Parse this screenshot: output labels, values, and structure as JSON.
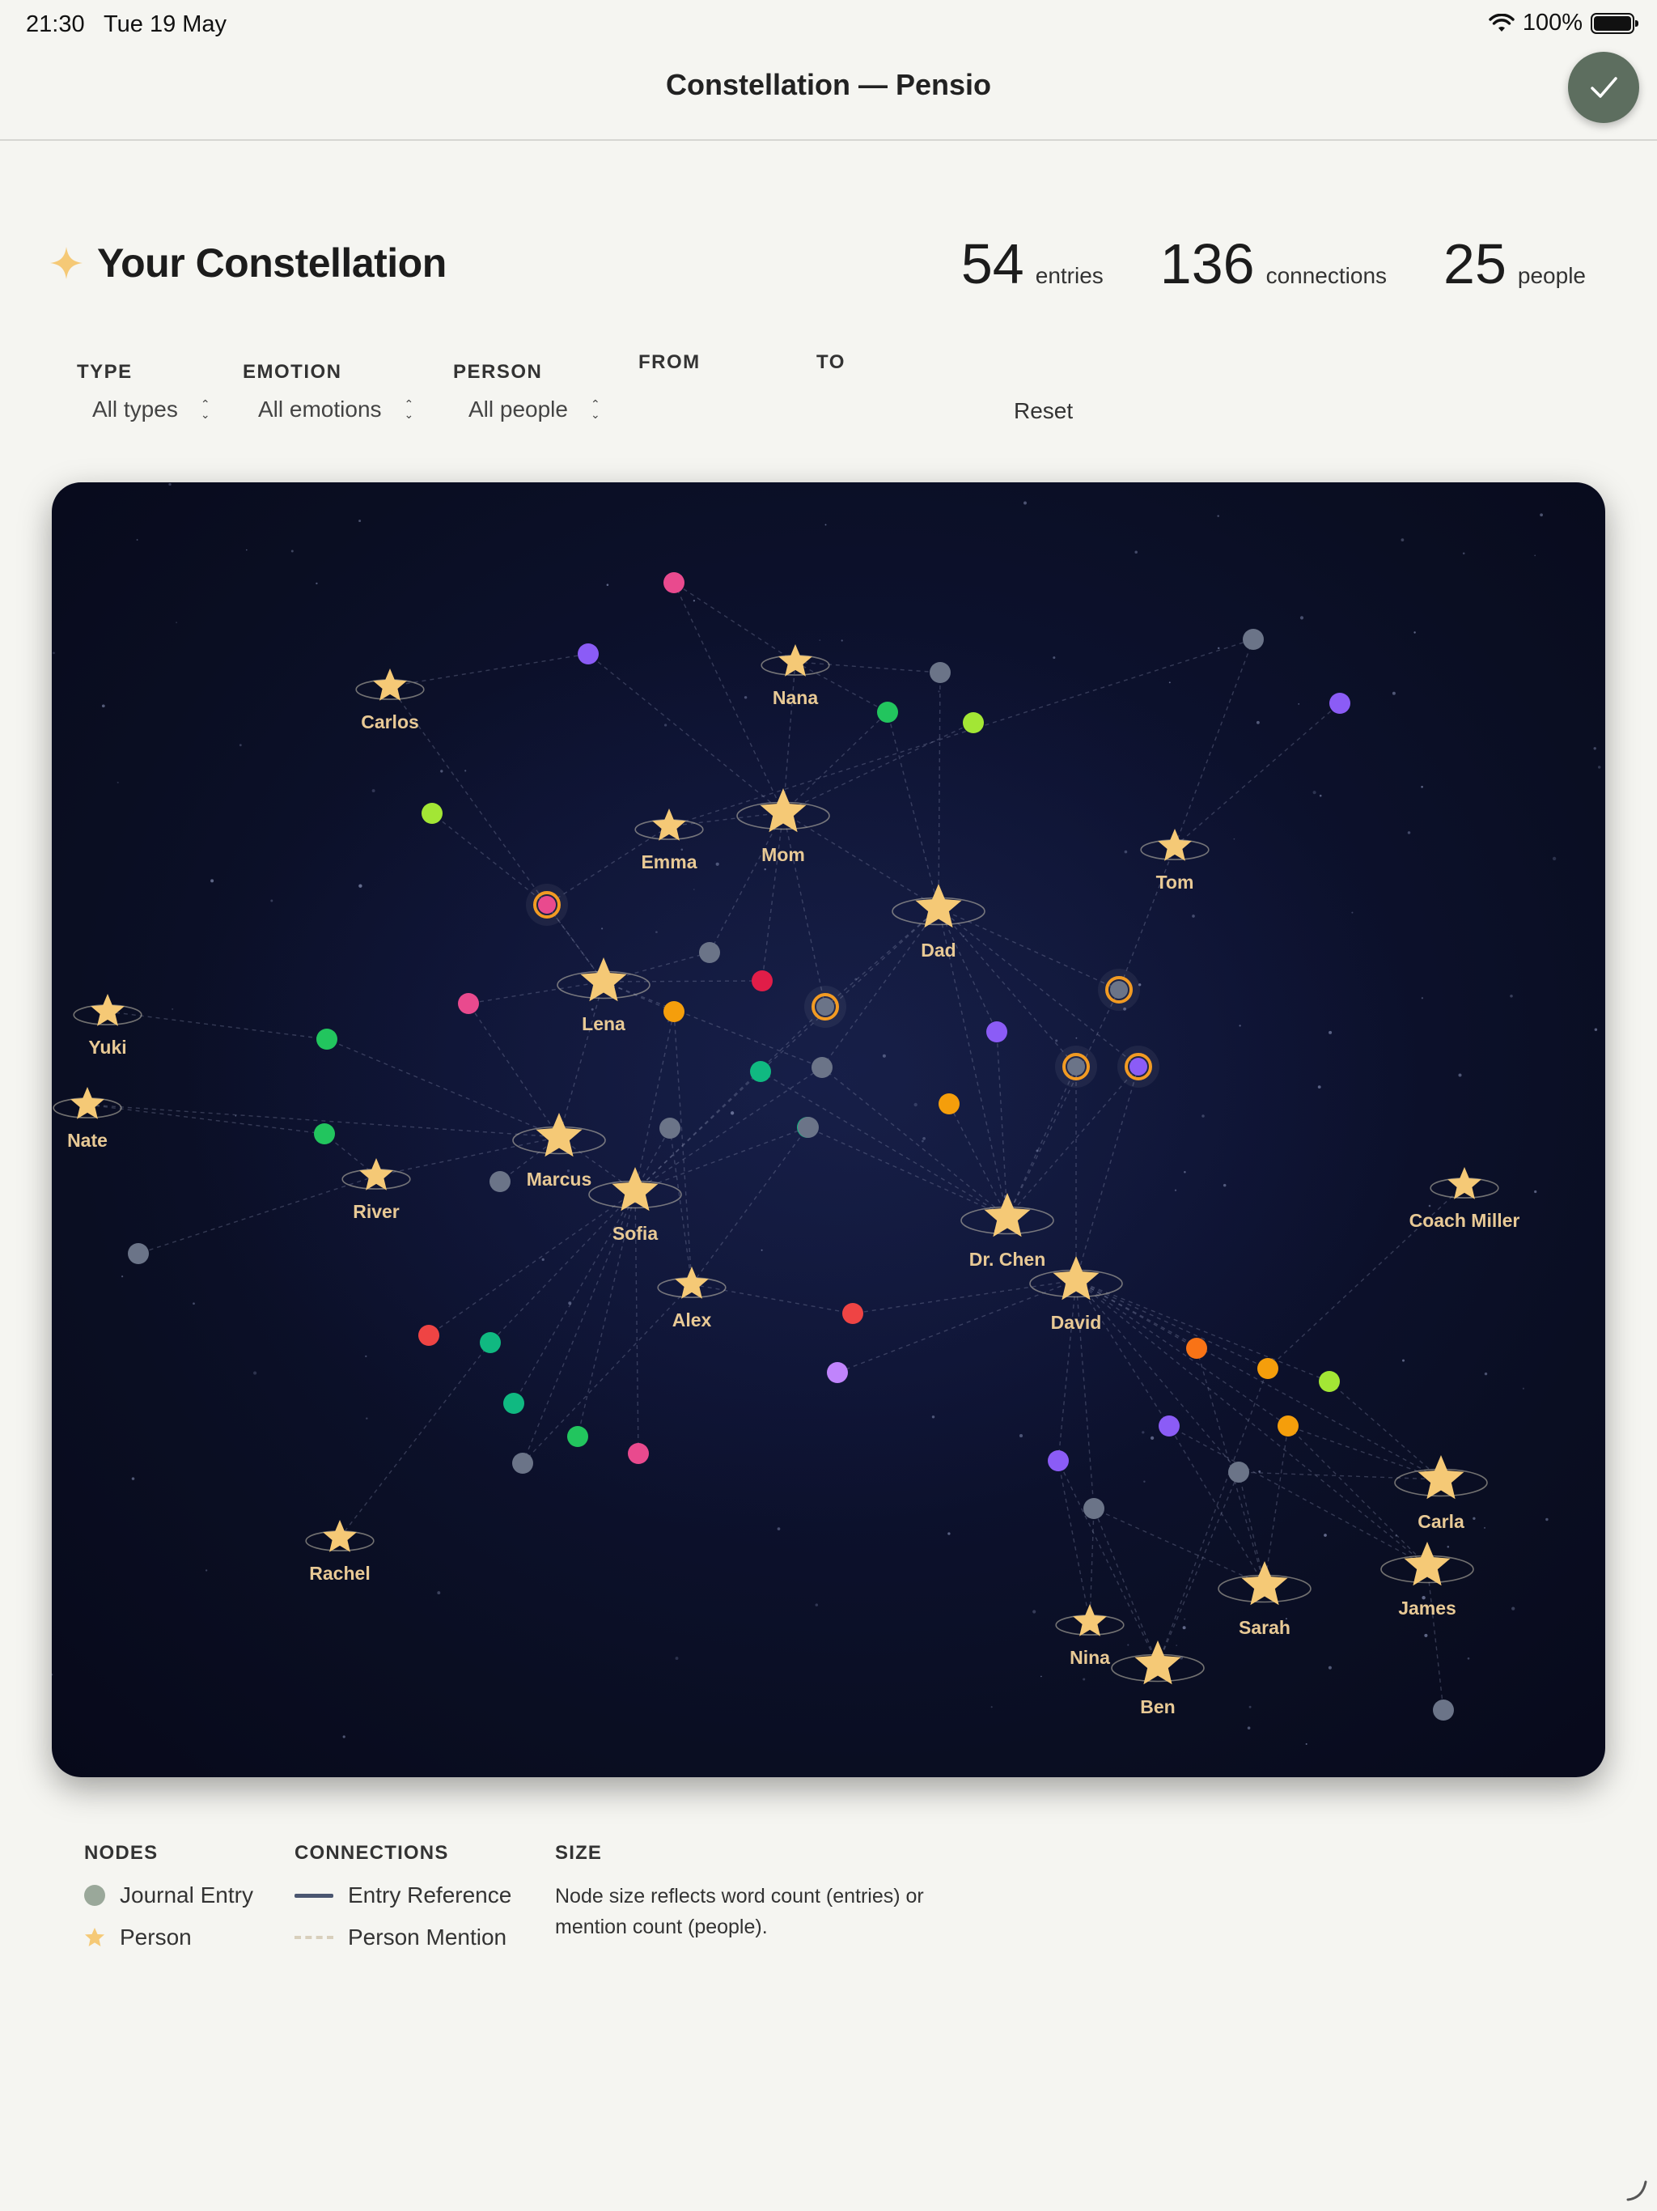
{
  "status_bar": {
    "time": "21:30",
    "date": "Tue 19 May",
    "battery": "100%"
  },
  "nav": {
    "title": "Constellation — Pensio",
    "done_icon": "checkmark-icon"
  },
  "header": {
    "title": "Your Constellation",
    "sparkle_icon": "sparkle-icon"
  },
  "stats": [
    {
      "value": "54",
      "label": "entries"
    },
    {
      "value": "136",
      "label": "connections"
    },
    {
      "value": "25",
      "label": "people"
    }
  ],
  "filters": {
    "type": {
      "label": "TYPE",
      "value": "All types"
    },
    "emotion": {
      "label": "EMOTION",
      "value": "All emotions"
    },
    "person": {
      "label": "PERSON",
      "value": "All people"
    },
    "from": {
      "label": "FROM"
    },
    "to": {
      "label": "TO"
    },
    "reset": "Reset"
  },
  "colors": {
    "star": "#f5c976",
    "star_label": "#e8c995",
    "canvas_bg": "#0b0f26",
    "highlight_ring": "#f29b23",
    "done_button": "#5d6e5f"
  },
  "graph": {
    "people": [
      {
        "id": "carlos",
        "name": "Carlos",
        "size": "medium"
      },
      {
        "id": "nana",
        "name": "Nana",
        "size": "medium"
      },
      {
        "id": "emma",
        "name": "Emma",
        "size": "medium"
      },
      {
        "id": "mom",
        "name": "Mom",
        "size": "large"
      },
      {
        "id": "dad",
        "name": "Dad",
        "size": "large"
      },
      {
        "id": "tom",
        "name": "Tom",
        "size": "medium"
      },
      {
        "id": "lena",
        "name": "Lena",
        "size": "large"
      },
      {
        "id": "yuki",
        "name": "Yuki",
        "size": "medium"
      },
      {
        "id": "nate",
        "name": "Nate",
        "size": "medium"
      },
      {
        "id": "marcus",
        "name": "Marcus",
        "size": "large"
      },
      {
        "id": "river",
        "name": "River",
        "size": "medium"
      },
      {
        "id": "sofia",
        "name": "Sofia",
        "size": "large"
      },
      {
        "id": "alex",
        "name": "Alex",
        "size": "medium"
      },
      {
        "id": "drchen",
        "name": "Dr. Chen",
        "size": "large"
      },
      {
        "id": "david",
        "name": "David",
        "size": "large"
      },
      {
        "id": "coach",
        "name": "Coach Miller",
        "size": "medium"
      },
      {
        "id": "rachel",
        "name": "Rachel",
        "size": "medium"
      },
      {
        "id": "carla",
        "name": "Carla",
        "size": "large"
      },
      {
        "id": "james",
        "name": "James",
        "size": "large"
      },
      {
        "id": "sarah",
        "name": "Sarah",
        "size": "large"
      },
      {
        "id": "nina",
        "name": "Nina",
        "size": "medium"
      },
      {
        "id": "ben",
        "name": "Ben",
        "size": "large"
      }
    ],
    "entries": [
      {
        "id": "e1",
        "color": "#e94a8e"
      },
      {
        "id": "e2",
        "color": "#8b5cf6"
      },
      {
        "id": "e3",
        "color": "#6b7488"
      },
      {
        "id": "e4",
        "color": "#22c55e"
      },
      {
        "id": "e5",
        "color": "#a3e635"
      },
      {
        "id": "e6",
        "color": "#6b7488"
      },
      {
        "id": "e7",
        "color": "#8b5cf6"
      },
      {
        "id": "e8",
        "color": "#a3e635"
      },
      {
        "id": "e9",
        "color": "#e94a8e",
        "highlight": true
      },
      {
        "id": "e10",
        "color": "#6b7488"
      },
      {
        "id": "e11",
        "color": "#e11d48"
      },
      {
        "id": "e12",
        "color": "#e94a8e"
      },
      {
        "id": "e13",
        "color": "#f59e0b"
      },
      {
        "id": "e14",
        "color": "#6b7488",
        "highlight": true
      },
      {
        "id": "e15",
        "color": "#6b7488",
        "highlight": true
      },
      {
        "id": "e16",
        "color": "#22c55e"
      },
      {
        "id": "e17",
        "color": "#8b5cf6"
      },
      {
        "id": "e18",
        "color": "#10b981"
      },
      {
        "id": "e19",
        "color": "#6b7488"
      },
      {
        "id": "e20",
        "color": "#6b7488",
        "highlight": true
      },
      {
        "id": "e21",
        "color": "#8b5cf6",
        "highlight": true
      },
      {
        "id": "e22",
        "color": "#22c55e"
      },
      {
        "id": "e23",
        "color": "#6b7488"
      },
      {
        "id": "e24",
        "color": "#6b7488"
      },
      {
        "id": "e25",
        "color": "#10b981"
      },
      {
        "id": "e26",
        "color": "#f59e0b"
      },
      {
        "id": "e27",
        "color": "#6b7488"
      },
      {
        "id": "e28",
        "color": "#6b7488"
      },
      {
        "id": "e29",
        "color": "#ef4444"
      },
      {
        "id": "e30",
        "color": "#10b981"
      },
      {
        "id": "e31",
        "color": "#ef4444"
      },
      {
        "id": "e32",
        "color": "#c084fc"
      },
      {
        "id": "e33",
        "color": "#10b981"
      },
      {
        "id": "e34",
        "color": "#22c55e"
      },
      {
        "id": "e35",
        "color": "#e94a8e"
      },
      {
        "id": "e36",
        "color": "#6b7488"
      },
      {
        "id": "e37",
        "color": "#f97316"
      },
      {
        "id": "e38",
        "color": "#f59e0b"
      },
      {
        "id": "e39",
        "color": "#a3e635"
      },
      {
        "id": "e40",
        "color": "#8b5cf6"
      },
      {
        "id": "e41",
        "color": "#f59e0b"
      },
      {
        "id": "e42",
        "color": "#8b5cf6"
      },
      {
        "id": "e43",
        "color": "#6b7488"
      },
      {
        "id": "e44",
        "color": "#6b7488"
      },
      {
        "id": "e45",
        "color": "#6b7488"
      }
    ],
    "edges": [
      [
        "carlos",
        "e2"
      ],
      [
        "carlos",
        "e9"
      ],
      [
        "nana",
        "e1"
      ],
      [
        "nana",
        "mom"
      ],
      [
        "nana",
        "e3"
      ],
      [
        "nana",
        "e4"
      ],
      [
        "mom",
        "e1"
      ],
      [
        "mom",
        "e2"
      ],
      [
        "mom",
        "e4"
      ],
      [
        "mom",
        "e5"
      ],
      [
        "mom",
        "emma"
      ],
      [
        "mom",
        "dad"
      ],
      [
        "mom",
        "e10"
      ],
      [
        "mom",
        "e11"
      ],
      [
        "mom",
        "e14"
      ],
      [
        "emma",
        "e9"
      ],
      [
        "emma",
        "e6"
      ],
      [
        "dad",
        "e3"
      ],
      [
        "dad",
        "e4"
      ],
      [
        "dad",
        "e14"
      ],
      [
        "dad",
        "e15"
      ],
      [
        "dad",
        "e20"
      ],
      [
        "dad",
        "e21"
      ],
      [
        "dad",
        "e17"
      ],
      [
        "dad",
        "e19"
      ],
      [
        "dad",
        "drchen"
      ],
      [
        "dad",
        "e18"
      ],
      [
        "tom",
        "e6"
      ],
      [
        "tom",
        "e7"
      ],
      [
        "tom",
        "e15"
      ],
      [
        "lena",
        "e9"
      ],
      [
        "lena",
        "e10"
      ],
      [
        "lena",
        "e11"
      ],
      [
        "lena",
        "e12"
      ],
      [
        "lena",
        "e13"
      ],
      [
        "lena",
        "marcus"
      ],
      [
        "lena",
        "e19"
      ],
      [
        "e9",
        "e8"
      ],
      [
        "e9",
        "lena"
      ],
      [
        "yuki",
        "e16"
      ],
      [
        "nate",
        "e22"
      ],
      [
        "nate",
        "marcus"
      ],
      [
        "river",
        "e44"
      ],
      [
        "river",
        "e22"
      ],
      [
        "river",
        "marcus"
      ],
      [
        "marcus",
        "e23"
      ],
      [
        "marcus",
        "e12"
      ],
      [
        "marcus",
        "e16"
      ],
      [
        "marcus",
        "sofia"
      ],
      [
        "sofia",
        "e13"
      ],
      [
        "sofia",
        "e18"
      ],
      [
        "sofia",
        "e24"
      ],
      [
        "sofia",
        "e25"
      ],
      [
        "sofia",
        "e29"
      ],
      [
        "sofia",
        "e30"
      ],
      [
        "sofia",
        "e33"
      ],
      [
        "sofia",
        "e34"
      ],
      [
        "sofia",
        "e35"
      ],
      [
        "sofia",
        "e36"
      ],
      [
        "sofia",
        "e19"
      ],
      [
        "sofia",
        "e14"
      ],
      [
        "alex",
        "e24"
      ],
      [
        "alex",
        "e25"
      ],
      [
        "alex",
        "e31"
      ],
      [
        "alex",
        "e13"
      ],
      [
        "alex",
        "e36"
      ],
      [
        "drchen",
        "e19"
      ],
      [
        "drchen",
        "e25"
      ],
      [
        "drchen",
        "e17"
      ],
      [
        "drchen",
        "e20"
      ],
      [
        "drchen",
        "e21"
      ],
      [
        "drchen",
        "e26"
      ],
      [
        "drchen",
        "e18"
      ],
      [
        "drchen",
        "e15"
      ],
      [
        "david",
        "e31"
      ],
      [
        "david",
        "e32"
      ],
      [
        "david",
        "e20"
      ],
      [
        "david",
        "e21"
      ],
      [
        "david",
        "e37"
      ],
      [
        "david",
        "e38"
      ],
      [
        "david",
        "e39"
      ],
      [
        "david",
        "e40"
      ],
      [
        "david",
        "e41"
      ],
      [
        "david",
        "e42"
      ],
      [
        "david",
        "e43"
      ],
      [
        "david",
        "e45"
      ],
      [
        "david",
        "carla"
      ],
      [
        "david",
        "james"
      ],
      [
        "coach",
        "e38"
      ],
      [
        "rachel",
        "e30"
      ],
      [
        "carla",
        "e39"
      ],
      [
        "carla",
        "e41"
      ],
      [
        "carla",
        "e43"
      ],
      [
        "james",
        "e41"
      ],
      [
        "james",
        "e28"
      ],
      [
        "james",
        "e40"
      ],
      [
        "sarah",
        "e37"
      ],
      [
        "sarah",
        "e40"
      ],
      [
        "sarah",
        "e43"
      ],
      [
        "sarah",
        "e41"
      ],
      [
        "sarah",
        "e45"
      ],
      [
        "nina",
        "e42"
      ],
      [
        "nina",
        "e45"
      ],
      [
        "ben",
        "e42"
      ],
      [
        "ben",
        "e43"
      ],
      [
        "ben",
        "e45"
      ],
      [
        "ben",
        "e38"
      ]
    ]
  },
  "legend": {
    "nodes": {
      "heading": "NODES",
      "entry_label": "Journal Entry",
      "person_label": "Person"
    },
    "connections": {
      "heading": "CONNECTIONS",
      "reference_label": "Entry Reference",
      "mention_label": "Person Mention"
    },
    "size": {
      "heading": "SIZE",
      "text": "Node size reflects word count (entries) or mention count (people)."
    }
  }
}
